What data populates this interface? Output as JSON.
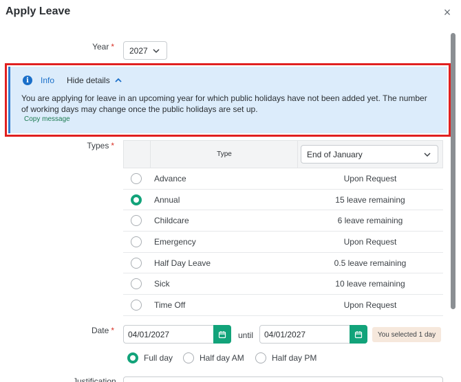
{
  "modal": {
    "title": "Apply Leave",
    "close": "×"
  },
  "year": {
    "label": "Year",
    "required": "*",
    "value": "2027"
  },
  "info": {
    "label": "Info",
    "toggle": "Hide details",
    "message": "You are applying for leave in an upcoming year for which public holidays have not been added yet. The number of working days may change once the public holidays are set up.",
    "copy": "Copy message",
    "accent": "#1a6fc9",
    "background": "#dcecfb"
  },
  "types": {
    "label": "Types",
    "required": "*",
    "header_type": "Type",
    "period": "End of January",
    "rows": [
      {
        "name": "Advance",
        "remaining": "Upon Request",
        "selected": false
      },
      {
        "name": "Annual",
        "remaining": "15 leave remaining",
        "selected": true
      },
      {
        "name": "Childcare",
        "remaining": "6 leave remaining",
        "selected": false
      },
      {
        "name": "Emergency",
        "remaining": "Upon Request",
        "selected": false
      },
      {
        "name": "Half Day Leave",
        "remaining": "0.5 leave remaining",
        "selected": false
      },
      {
        "name": "Sick",
        "remaining": "10 leave remaining",
        "selected": false
      },
      {
        "name": "Time Off",
        "remaining": "Upon Request",
        "selected": false
      }
    ]
  },
  "date": {
    "label": "Date",
    "required": "*",
    "from": "04/01/2027",
    "until_label": "until",
    "to": "04/01/2027",
    "selected_badge": "You selected 1 day",
    "options": [
      {
        "label": "Full day",
        "selected": true
      },
      {
        "label": "Half day AM",
        "selected": false
      },
      {
        "label": "Half day PM",
        "selected": false
      }
    ]
  },
  "justification": {
    "label": "Justification"
  },
  "colors": {
    "primary": "#12a37a",
    "required": "#d93025",
    "highlight": "#e02020"
  }
}
